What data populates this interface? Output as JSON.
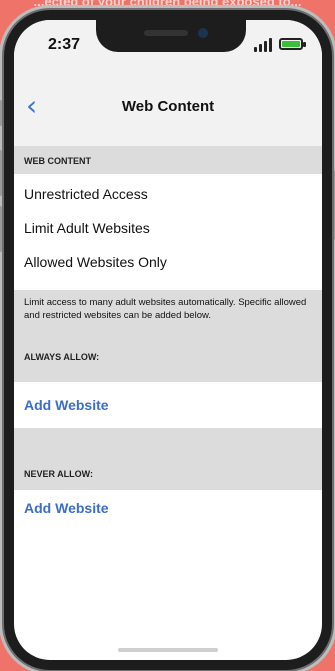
{
  "banner": {
    "text": "...ected of your children being exposed to..."
  },
  "status_bar": {
    "time": "2:37"
  },
  "nav": {
    "title": "Web Content",
    "back_icon": "chevron-left-icon"
  },
  "sections": {
    "web_content_header": "WEB CONTENT",
    "options": [
      "Unrestricted Access",
      "Limit Adult Websites",
      "Allowed Websites Only"
    ],
    "description": "Limit access to many adult websites automatically. Specific allowed and restricted websites can be added below.",
    "always_allow_header": "ALWAYS ALLOW:",
    "always_allow_add": "Add Website",
    "never_allow_header": "NEVER ALLOW:",
    "never_allow_add": "Add Website"
  },
  "colors": {
    "background": "#f0736a",
    "accent": "#3b6ec4",
    "battery": "#3bbf3b"
  }
}
